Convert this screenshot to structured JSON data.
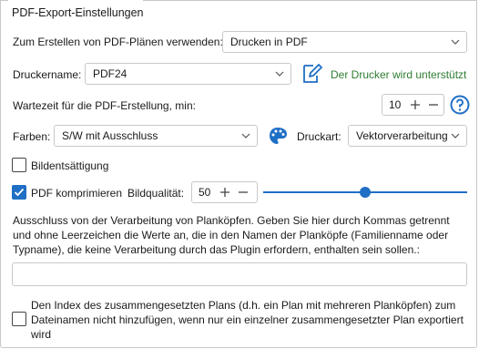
{
  "group_title": "PDF-Export-Einstellungen",
  "create_plans": {
    "label": "Zum Erstellen von PDF-Plänen verwenden:",
    "selected": "Drucken in PDF"
  },
  "printer": {
    "label": "Druckername:",
    "selected": "PDF24",
    "supported_text": "Der Drucker wird unterstützt"
  },
  "wait_time": {
    "label": "Wartezeit für die PDF-Erstellung, min:",
    "value": "10"
  },
  "colors": {
    "label": "Farben:",
    "selected": "S/W mit Ausschluss"
  },
  "print_type": {
    "label": "Druckart:",
    "selected": "Vektorverarbeitung"
  },
  "image_saturation": {
    "label": "Bildentsättigung",
    "checked": false
  },
  "compress": {
    "label": "PDF komprimieren",
    "checked": true,
    "quality_label": "Bildqualität:",
    "quality_value": "50",
    "slider_fraction": 0.5
  },
  "exclusion": {
    "description": "Ausschluss von der Verarbeitung von Planköpfen. Geben Sie hier durch Kommas getrennt und ohne Leerzeichen die Werte an, die in den Namen der Planköpfe (Familienname oder Typname), die keine Verarbeitung durch das Plugin erfordern, enthalten sein sollen.:",
    "value": ""
  },
  "index_option": {
    "label": "Den Index des zusammengesetzten Plans (d.h. ein Plan mit mehreren Planköpfen) zum Dateinamen nicht hinzufügen, wenn nur ein einzelner zusammengesetzter Plan exportiert wird",
    "checked": false
  },
  "colors_palette": {
    "accent": "#1f6fc5",
    "success": "#2e7d32"
  },
  "icons": [
    "chevron-down-icon",
    "edit-icon",
    "plus-icon",
    "minus-icon",
    "help-icon",
    "palette-icon",
    "checkmark-icon"
  ]
}
